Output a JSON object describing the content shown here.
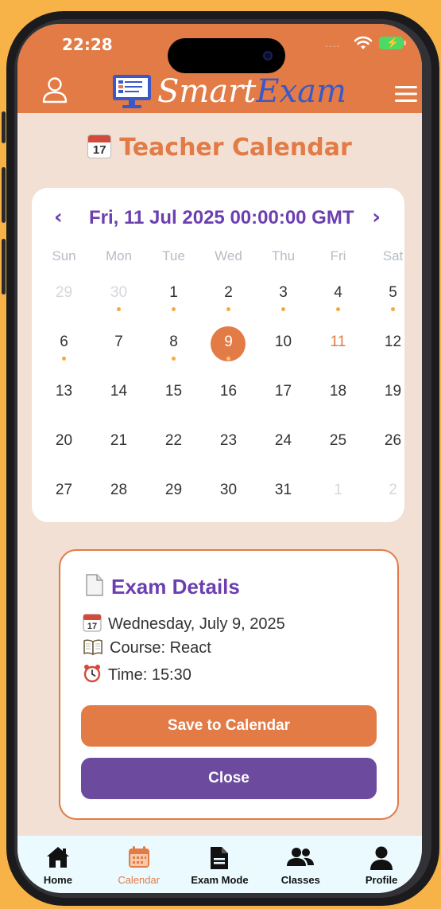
{
  "status_bar": {
    "time": "22:28",
    "signal_dots": "....",
    "accent_color": "#e27b46"
  },
  "header": {
    "logo_smart": "Smart",
    "logo_exam": "Exam"
  },
  "page": {
    "title": "Teacher Calendar",
    "emoji_day": "17"
  },
  "calendar": {
    "selected_label": "Fri, 11 Jul 2025 00:00:00 GMT",
    "prev_label": "‹",
    "next_label": "›",
    "weekdays": [
      "Sun",
      "Mon",
      "Tue",
      "Wed",
      "Thu",
      "Fri",
      "Sat"
    ],
    "weeks": [
      [
        {
          "d": "29",
          "muted": true
        },
        {
          "d": "30",
          "muted": true,
          "dot": true
        },
        {
          "d": "1",
          "dot": true
        },
        {
          "d": "2",
          "dot": true
        },
        {
          "d": "3",
          "dot": true
        },
        {
          "d": "4",
          "dot": true
        },
        {
          "d": "5",
          "dot": true
        }
      ],
      [
        {
          "d": "6",
          "dot": true
        },
        {
          "d": "7"
        },
        {
          "d": "8",
          "dot": true
        },
        {
          "d": "9",
          "selected": true,
          "dot": true
        },
        {
          "d": "10"
        },
        {
          "d": "11",
          "today": true
        },
        {
          "d": "12"
        }
      ],
      [
        {
          "d": "13"
        },
        {
          "d": "14"
        },
        {
          "d": "15"
        },
        {
          "d": "16"
        },
        {
          "d": "17"
        },
        {
          "d": "18"
        },
        {
          "d": "19"
        }
      ],
      [
        {
          "d": "20"
        },
        {
          "d": "21"
        },
        {
          "d": "22"
        },
        {
          "d": "23"
        },
        {
          "d": "24"
        },
        {
          "d": "25"
        },
        {
          "d": "26"
        }
      ],
      [
        {
          "d": "27"
        },
        {
          "d": "28"
        },
        {
          "d": "29"
        },
        {
          "d": "30"
        },
        {
          "d": "31"
        },
        {
          "d": "1",
          "muted": true
        },
        {
          "d": "2",
          "muted": true
        }
      ]
    ]
  },
  "exam_details": {
    "title": "Exam Details",
    "date": "Wednesday, July 9, 2025",
    "course": "Course: React",
    "time": "Time: 15:30",
    "save_label": "Save to Calendar",
    "close_label": "Close"
  },
  "nav": {
    "items": [
      {
        "label": "Home",
        "icon": "home-icon"
      },
      {
        "label": "Calendar",
        "icon": "calendar-icon",
        "active": true
      },
      {
        "label": "Exam Mode",
        "icon": "document-icon"
      },
      {
        "label": "Classes",
        "icon": "users-icon"
      },
      {
        "label": "Profile",
        "icon": "profile-icon"
      }
    ]
  }
}
